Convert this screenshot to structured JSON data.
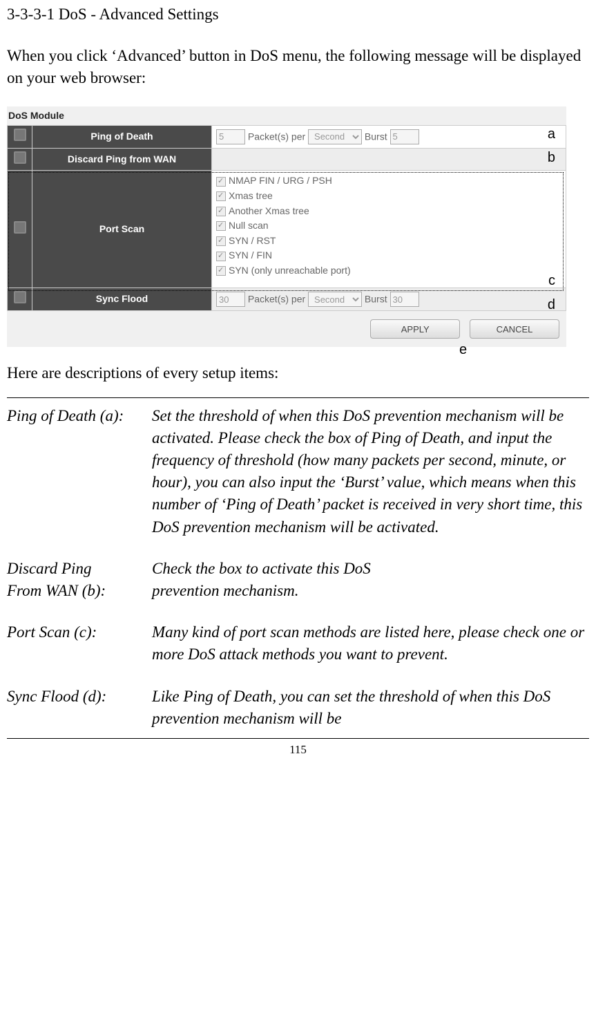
{
  "section_title": "3-3-3-1 DoS - Advanced Settings",
  "intro_text": "When you click ‘Advanced’ button in DoS menu, the following message will be displayed on your web browser:",
  "module": {
    "header": "DoS Module",
    "rows": {
      "ping_of_death": {
        "label": "Ping of Death",
        "packets_value": "5",
        "packets_per_label": "Packet(s) per",
        "time_unit": "Second",
        "burst_label": "Burst",
        "burst_value": "5",
        "annot": "a"
      },
      "discard_ping": {
        "label": "Discard Ping from WAN",
        "annot": "b"
      },
      "port_scan": {
        "label": "Port Scan",
        "options": [
          "NMAP FIN / URG / PSH",
          "Xmas tree",
          "Another Xmas tree",
          "Null scan",
          "SYN / RST",
          "SYN / FIN",
          "SYN (only unreachable port)"
        ],
        "annot": "c"
      },
      "sync_flood": {
        "label": "Sync Flood",
        "packets_value": "30",
        "packets_per_label": "Packet(s) per",
        "time_unit": "Second",
        "burst_label": "Burst",
        "burst_value": "30",
        "annot": "d"
      }
    },
    "buttons": {
      "apply": "APPLY",
      "cancel": "CANCEL",
      "annot": "e"
    }
  },
  "desc_intro": "Here are descriptions of every setup items:",
  "descriptions": [
    {
      "label": "Ping of Death (a):",
      "text": "Set the threshold of when this DoS prevention mechanism will be activated. Please check the box of Ping of Death, and input the frequency of threshold (how many packets per second, minute, or hour), you can also input the ‘Burst’ value, which means when this number of ‘Ping of Death’ packet is received in very short time, this DoS prevention mechanism will be activated."
    },
    {
      "label_line1": "Discard Ping",
      "label_line2": "From WAN (b):",
      "text_line1": "Check the box to activate this DoS",
      "text_line2": "prevention mechanism."
    },
    {
      "label": "Port Scan (c):",
      "text": "Many kind of port scan methods are listed here, please check one or more DoS attack methods you want to prevent."
    },
    {
      "label": "Sync Flood (d):",
      "text": "Like Ping of Death, you can set the threshold of when this DoS prevention mechanism will be"
    }
  ],
  "page_number": "115"
}
